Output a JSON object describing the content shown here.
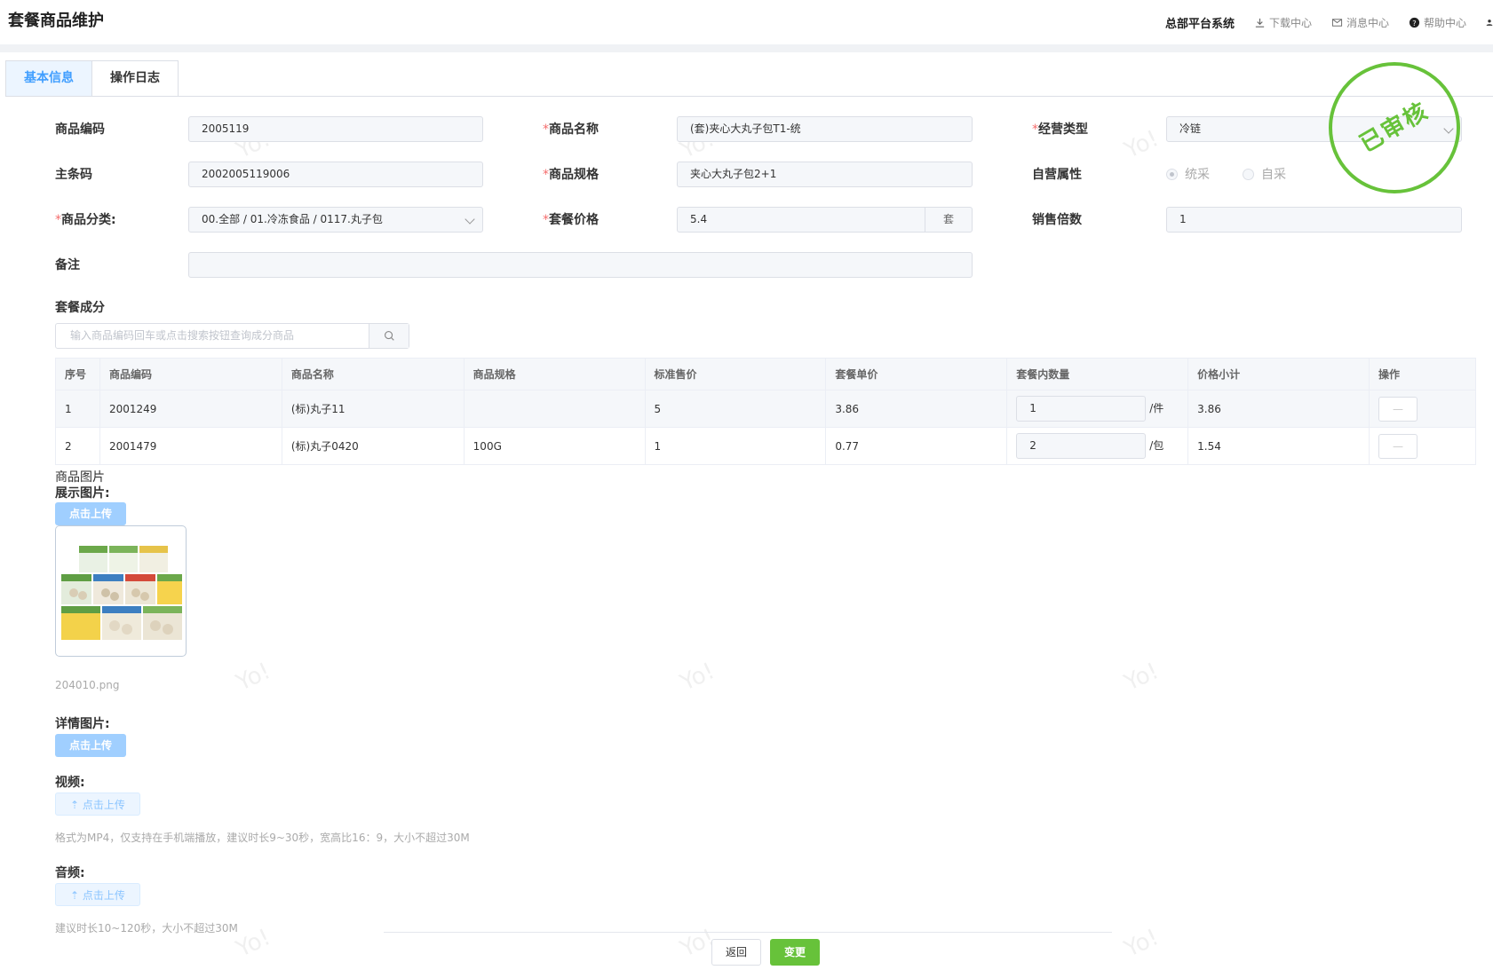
{
  "header": {
    "page_title": "套餐商品维护",
    "system_name": "总部平台系统",
    "links": [
      {
        "label": "下载中心",
        "icon": "download-icon"
      },
      {
        "label": "消息中心",
        "icon": "mail-icon"
      },
      {
        "label": "帮助中心",
        "icon": "help-icon"
      }
    ]
  },
  "tabs": [
    {
      "label": "基本信息",
      "active": true
    },
    {
      "label": "操作日志",
      "active": false
    }
  ],
  "form": {
    "code": {
      "label": "商品编码",
      "value": "2005119"
    },
    "name": {
      "label": "商品名称",
      "required": "*",
      "value": "(套)夹心大丸子包T1-统"
    },
    "biz_type": {
      "label": "经营类型",
      "required": "*",
      "value": "冷链"
    },
    "barcode": {
      "label": "主条码",
      "value": "2002005119006"
    },
    "spec": {
      "label": "商品规格",
      "required": "*",
      "value": "夹心大丸子包2+1"
    },
    "self_attr": {
      "label": "自营属性",
      "options": [
        "统采",
        "自采"
      ],
      "selected": "统采"
    },
    "category": {
      "label": "商品分类:",
      "required": "*",
      "value": "00.全部 / 01.冷冻食品 / 0117.丸子包"
    },
    "price": {
      "label": "套餐价格",
      "required": "*",
      "value": "5.4",
      "unit": "套"
    },
    "multiple": {
      "label": "销售倍数",
      "value": "1"
    },
    "remark": {
      "label": "备注",
      "value": ""
    }
  },
  "components": {
    "section_title": "套餐成分",
    "search_placeholder": "输入商品编码回车或点击搜索按钮查询成分商品",
    "columns": [
      "序号",
      "商品编码",
      "商品名称",
      "商品规格",
      "标准售价",
      "套餐单价",
      "套餐内数量",
      "价格小计",
      "操作"
    ],
    "rows": [
      {
        "idx": "1",
        "code": "2001249",
        "name": "(标)丸子11",
        "spec": "",
        "std_price": "5",
        "unit_price": "3.86",
        "qty": "1",
        "qty_unit": "/件",
        "subtotal": "3.86",
        "op": "—"
      },
      {
        "idx": "2",
        "code": "2001479",
        "name": "(标)丸子0420",
        "spec": "100G",
        "std_price": "1",
        "unit_price": "0.77",
        "qty": "2",
        "qty_unit": "/包",
        "subtotal": "1.54",
        "op": "—"
      }
    ]
  },
  "media": {
    "section_title": "商品图片",
    "display_label": "展示图片:",
    "upload_label": "点击上传",
    "filename": "204010.png",
    "detail_label": "详情图片:",
    "video_label": "视频:",
    "video_hint": "格式为MP4，仅支持在手机端播放，建议时长9~30秒，宽高比16：9，大小不超过30M",
    "audio_label": "音频:",
    "audio_hint": "建议时长10~120秒，大小不超过30M"
  },
  "stamp": {
    "text": "已审核",
    "color": "#67c23a"
  },
  "watermark": "Yo!",
  "actions": {
    "back": "返回",
    "change": "变更"
  },
  "colors": {
    "primary": "#409eff",
    "success": "#67c23a",
    "required": "#f56c6c"
  }
}
